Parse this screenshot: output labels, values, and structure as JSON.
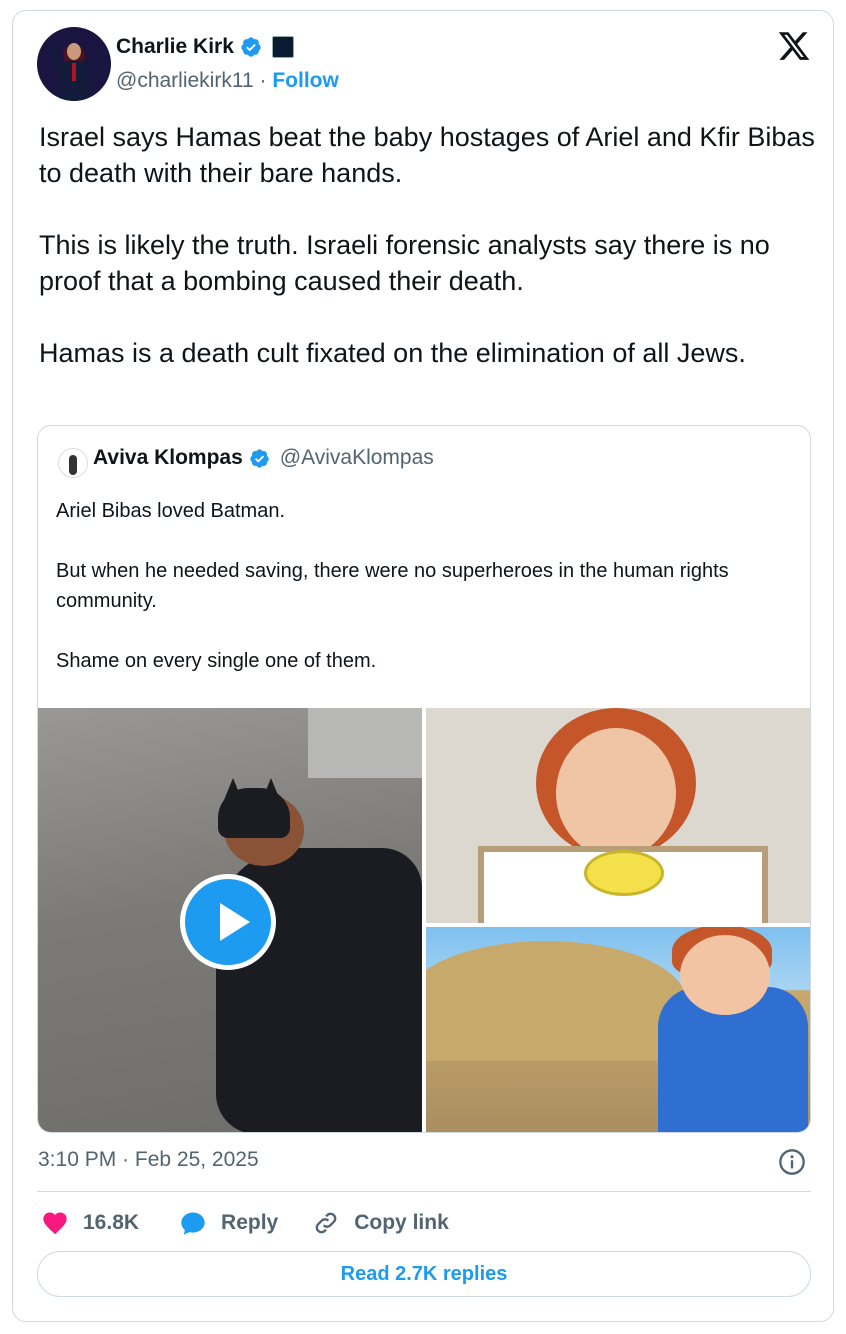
{
  "author": {
    "name": "Charlie Kirk",
    "handle": "@charliekirk11",
    "separator": "·",
    "follow_label": "Follow"
  },
  "tweet": {
    "paragraphs": [
      "Israel says Hamas beat the baby hostages of Ariel and Kfir Bibas to death with their bare hands.",
      "This is likely the truth. Israeli forensic analysts say there is no proof that a bombing caused their death.",
      "Hamas is a death cult fixated on the elimination of all Jews."
    ]
  },
  "quote": {
    "name": "Aviva Klompas",
    "handle": "@AvivaKlompas",
    "paragraphs": [
      "Ariel Bibas loved Batman.",
      "But when he needed saving, there were no superheroes in the human rights community.",
      "Shame on every single one of them."
    ]
  },
  "timestamp": "3:10 PM · Feb 25, 2025",
  "actions": {
    "likes": "16.8K",
    "reply_label": "Reply",
    "copy_label": "Copy link"
  },
  "read_replies_label": "Read 2.7K replies",
  "colors": {
    "accent": "#1d9bf0",
    "like": "#f91880",
    "text": "#0f1419",
    "muted": "#536471",
    "border": "#cfd9de"
  },
  "icons": [
    "verified-icon",
    "affiliation-badge-icon",
    "x-logo-icon",
    "play-icon",
    "info-icon",
    "heart-icon",
    "reply-icon",
    "link-icon"
  ]
}
